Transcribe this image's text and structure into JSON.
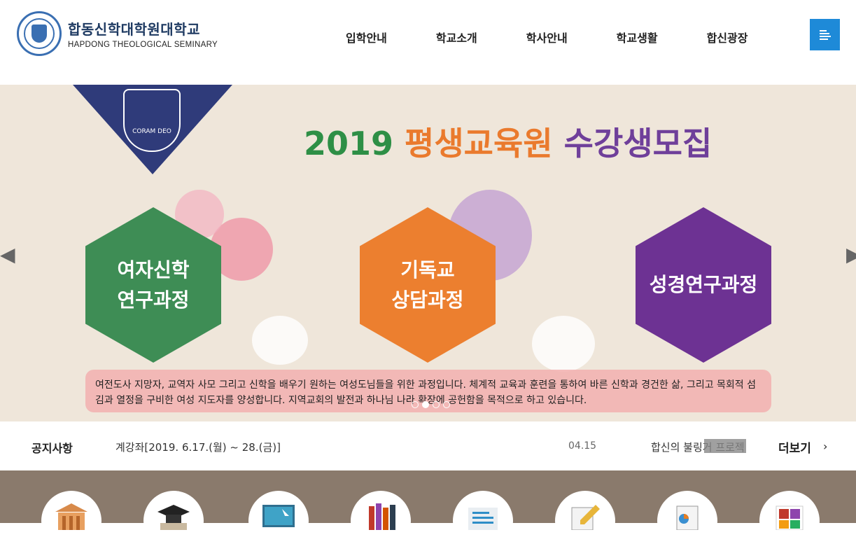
{
  "logo": {
    "name_ko": "합동신학대학원대학교",
    "name_en": "HAPDONG THEOLOGICAL SEMINARY"
  },
  "nav": [
    "입학안내",
    "학교소개",
    "학사안내",
    "학교생활",
    "합신광장"
  ],
  "hero": {
    "emblem_text": "CORAM DEO",
    "title_year": "2019",
    "title_mid": "평생교육원",
    "title_end": "수강생모집",
    "courses": [
      "여자신학\n연구과정",
      "기독교\n상담과정",
      "성경연구과정"
    ],
    "description": "여전도사 지망자, 교역자 사모 그리고 신학을 배우기 원하는 여성도님들을 위한 과정입니다. 체계적 교육과 훈련을 통하여 바른 신학과 경건한 삶, 그리고 목회적 섬김과 열정을 구비한 여성 지도자를 양성합니다. 지역교회의 발전과 하나님 나라 확장에 공헌함을 목적으로 하고 있습니다."
  },
  "notice": {
    "label": "공지사항",
    "item": "계강좌[2019. 6.17.(월) ~ 28.(금)]",
    "date": "04.15",
    "item2": "합신의 불링거 프로젝",
    "more": "더보기"
  },
  "quick_icons": [
    "building-icon",
    "graduation-cap-icon",
    "computer-click-icon",
    "books-icon",
    "newsletter-icon",
    "edit-pencil-icon",
    "report-chart-icon",
    "gallery-icon"
  ]
}
